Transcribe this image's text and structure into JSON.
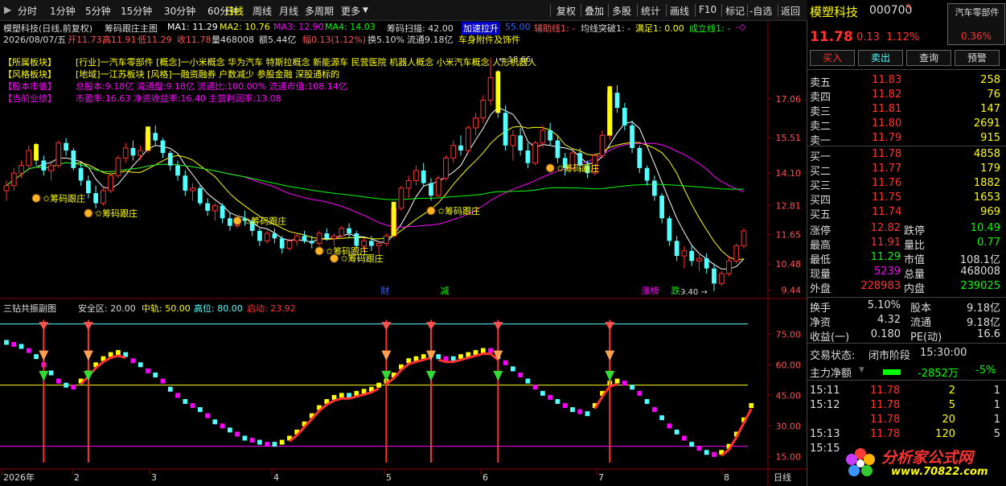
{
  "menu": {
    "periods": [
      "分时",
      "1分钟",
      "5分钟",
      "15分钟",
      "30分钟",
      "60分钟",
      "日线",
      "周线",
      "月线",
      "多周期",
      "更多"
    ],
    "active_period": "日线",
    "tools": [
      "复权",
      "叠加",
      "多股",
      "统计",
      "画线",
      "F10",
      "标记",
      "-自选",
      "返回"
    ]
  },
  "header": {
    "title": "模塑科技(日线,前复权)",
    "indicator_name": "筹码跟庄主图",
    "ma1": "MA1: 11.29",
    "ma2": "MA2: 10.76",
    "ma3": "MA3: 12.90",
    "ma4": "MA4: 14.03",
    "scan": "筹码扫描: 42.00",
    "strong_label": "加速拉升",
    "strong_value": "55.00",
    "aux": "辅助线1: -",
    "breakout": "均线突破1: -",
    "satisfied": "满足1: 0.00",
    "formed": "成立线1: -",
    "date_line": "2026/08/07/五",
    "open": "开11.73",
    "high": "高11.91",
    "low": "低11.29",
    "close": "收11.78",
    "volume": "量468008",
    "amount": "额5.44亿",
    "amplitude": "幅0.13(1.12%)",
    "turnover": "换5.10%",
    "float": "流通9.18亿",
    "industry": "车身附件及饰件"
  },
  "info": {
    "sector_label": "【所属板块】",
    "sector_value": "[行业]一汽车零部件 [概念]一小米概念 华为汽车 特斯拉概念 新能源车 民营医院 机器人概念 小米汽车概念 人形机器人",
    "style_label": "【风格板块】",
    "style_value": "[地域]一江苏板块 [风格]一融资融券 户数减少 参股金融 深股通标的",
    "capital_label": "【股本市值】",
    "capital_value": "总股本:9.18亿 流通盘:9.18亿 流通比:100.00% 流通市值:108.14亿",
    "perf_label": "【当前业绩】",
    "perf_value": "市盈率:16.63 净资收益率:16.40 主营利润率:13.08"
  },
  "main_chart": {
    "price_ticks": [
      "17.06",
      "15.51",
      "14.10",
      "12.81",
      "11.65",
      "10.48",
      "9.44"
    ],
    "peak_label": "18.66",
    "low_label": "9.40",
    "marker_label": "筹码跟庄",
    "event_tags": [
      "财",
      "减",
      "涨榜",
      "跌"
    ]
  },
  "sub_chart": {
    "title": "三钻共振副图",
    "safe": "安全区: 20.00",
    "mid": "中轨: 50.00",
    "high": "高位: 80.00",
    "start": "启动: 23.92",
    "ticks": [
      "75.00",
      "60.00",
      "45.00",
      "30.00",
      "15.00"
    ]
  },
  "x_axis": {
    "labels": [
      "2026年",
      "2",
      "3",
      "4",
      "5",
      "6",
      "7",
      "8"
    ],
    "period": "日线"
  },
  "chart_data": {
    "type": "candlestick",
    "note": "",
    "ohlc": [
      [
        13.4,
        13.8,
        13.0,
        13.6
      ],
      [
        13.6,
        14.3,
        13.4,
        14.1
      ],
      [
        14.1,
        14.6,
        13.9,
        14.4
      ],
      [
        14.4,
        15.2,
        14.2,
        15.0
      ],
      [
        15.0,
        15.3,
        14.4,
        14.6
      ],
      [
        14.6,
        14.8,
        14.0,
        14.2
      ],
      [
        14.2,
        14.6,
        13.8,
        14.4
      ],
      [
        14.4,
        15.4,
        14.3,
        15.3
      ],
      [
        15.3,
        15.5,
        14.8,
        15.0
      ],
      [
        15.0,
        15.1,
        14.2,
        14.3
      ],
      [
        14.3,
        14.5,
        13.6,
        13.8
      ],
      [
        13.8,
        14.0,
        13.1,
        13.3
      ],
      [
        13.3,
        13.6,
        12.7,
        12.9
      ],
      [
        12.9,
        13.5,
        12.8,
        13.4
      ],
      [
        13.4,
        14.2,
        13.3,
        14.0
      ],
      [
        14.0,
        14.8,
        13.9,
        14.7
      ],
      [
        14.7,
        15.3,
        14.5,
        15.1
      ],
      [
        15.1,
        15.4,
        14.6,
        14.8
      ],
      [
        14.8,
        15.2,
        14.6,
        15.0
      ],
      [
        15.0,
        15.9,
        14.9,
        15.7
      ],
      [
        15.7,
        16.0,
        15.2,
        15.4
      ],
      [
        15.4,
        15.5,
        14.7,
        14.9
      ],
      [
        14.9,
        15.0,
        14.2,
        14.4
      ],
      [
        14.4,
        14.6,
        13.8,
        14.0
      ],
      [
        14.0,
        14.2,
        13.2,
        13.4
      ],
      [
        13.4,
        13.7,
        13.0,
        13.5
      ],
      [
        13.5,
        13.6,
        12.8,
        12.9
      ],
      [
        12.9,
        13.1,
        12.4,
        12.6
      ],
      [
        12.6,
        12.9,
        12.2,
        12.8
      ],
      [
        12.8,
        12.9,
        12.1,
        12.3
      ],
      [
        12.3,
        12.5,
        11.8,
        12.0
      ],
      [
        12.0,
        12.4,
        11.9,
        12.3
      ],
      [
        12.3,
        12.6,
        12.0,
        12.2
      ],
      [
        12.2,
        12.3,
        11.6,
        11.8
      ],
      [
        11.8,
        11.9,
        11.2,
        11.4
      ],
      [
        11.4,
        11.8,
        11.3,
        11.7
      ],
      [
        11.7,
        11.9,
        11.3,
        11.5
      ],
      [
        11.5,
        11.6,
        10.9,
        11.1
      ],
      [
        11.1,
        11.5,
        11.0,
        11.4
      ],
      [
        11.4,
        11.7,
        11.2,
        11.6
      ],
      [
        11.6,
        11.8,
        11.3,
        11.4
      ],
      [
        11.4,
        11.6,
        11.1,
        11.3
      ],
      [
        11.3,
        11.8,
        11.2,
        11.7
      ],
      [
        11.7,
        11.9,
        11.4,
        11.5
      ],
      [
        11.5,
        11.7,
        11.2,
        11.6
      ],
      [
        11.6,
        12.0,
        11.5,
        11.9
      ],
      [
        11.9,
        12.1,
        11.5,
        11.7
      ],
      [
        11.7,
        11.8,
        11.1,
        11.2
      ],
      [
        11.2,
        11.5,
        11.0,
        11.4
      ],
      [
        11.4,
        11.6,
        11.0,
        11.2
      ],
      [
        11.2,
        11.4,
        10.9,
        11.3
      ],
      [
        11.3,
        11.7,
        11.2,
        11.6
      ],
      [
        11.6,
        12.8,
        11.5,
        12.7
      ],
      [
        12.7,
        13.6,
        12.6,
        13.5
      ],
      [
        13.5,
        14.0,
        13.1,
        13.8
      ],
      [
        13.8,
        14.4,
        13.6,
        14.2
      ],
      [
        14.2,
        14.5,
        13.6,
        13.7
      ],
      [
        13.7,
        13.9,
        13.0,
        13.2
      ],
      [
        13.2,
        14.0,
        13.1,
        13.9
      ],
      [
        13.9,
        14.8,
        13.8,
        14.7
      ],
      [
        14.7,
        15.4,
        14.5,
        15.2
      ],
      [
        15.2,
        15.6,
        14.8,
        15.0
      ],
      [
        15.0,
        16.0,
        14.9,
        15.9
      ],
      [
        15.9,
        16.5,
        15.6,
        16.3
      ],
      [
        16.3,
        17.2,
        16.1,
        17.0
      ],
      [
        17.0,
        18.7,
        16.8,
        17.9
      ],
      [
        17.9,
        18.2,
        16.3,
        16.5
      ],
      [
        16.5,
        16.8,
        15.0,
        15.2
      ],
      [
        15.2,
        15.8,
        14.6,
        15.6
      ],
      [
        15.6,
        15.9,
        14.8,
        15.0
      ],
      [
        15.0,
        15.3,
        14.3,
        14.5
      ],
      [
        14.5,
        15.4,
        14.4,
        15.3
      ],
      [
        15.3,
        16.0,
        15.1,
        15.8
      ],
      [
        15.8,
        16.1,
        15.2,
        15.4
      ],
      [
        15.4,
        15.6,
        14.5,
        14.7
      ],
      [
        14.7,
        14.9,
        14.0,
        14.3
      ],
      [
        14.3,
        15.0,
        14.2,
        14.9
      ],
      [
        14.9,
        15.1,
        14.2,
        14.4
      ],
      [
        14.4,
        14.6,
        13.9,
        14.1
      ],
      [
        14.1,
        14.9,
        14.0,
        14.8
      ],
      [
        14.8,
        15.8,
        14.7,
        15.6
      ],
      [
        15.6,
        17.6,
        15.4,
        17.3
      ],
      [
        17.3,
        17.6,
        16.5,
        16.7
      ],
      [
        16.7,
        16.9,
        15.8,
        16.0
      ],
      [
        16.0,
        16.2,
        14.9,
        15.1
      ],
      [
        15.1,
        15.2,
        14.1,
        14.3
      ],
      [
        14.3,
        14.4,
        13.6,
        13.8
      ],
      [
        13.8,
        14.0,
        13.0,
        13.2
      ],
      [
        13.2,
        13.3,
        12.1,
        12.3
      ],
      [
        12.3,
        12.4,
        11.2,
        11.4
      ],
      [
        11.4,
        11.6,
        10.6,
        10.8
      ],
      [
        10.8,
        11.2,
        10.3,
        11.0
      ],
      [
        11.0,
        11.2,
        10.4,
        10.6
      ],
      [
        10.6,
        10.9,
        10.2,
        10.7
      ],
      [
        10.7,
        10.9,
        10.1,
        10.3
      ],
      [
        10.3,
        10.5,
        9.4,
        9.7
      ],
      [
        9.7,
        10.2,
        9.6,
        10.1
      ],
      [
        10.1,
        10.8,
        10.0,
        10.6
      ],
      [
        10.6,
        11.3,
        10.5,
        11.2
      ],
      [
        11.2,
        11.9,
        11.1,
        11.8
      ]
    ],
    "price_range": [
      9.2,
      19.2
    ],
    "sub_range": [
      10,
      85
    ],
    "sub_levels": [
      20,
      50,
      80
    ],
    "osc": [
      71,
      70,
      69,
      67,
      64,
      60,
      56,
      52,
      50,
      49,
      52,
      56,
      60,
      63,
      65,
      66,
      65,
      62,
      60,
      57,
      55,
      52,
      48,
      45,
      42,
      40,
      38,
      35,
      32,
      30,
      28,
      26,
      24,
      23,
      22,
      21,
      21,
      22,
      24,
      27,
      31,
      35,
      39,
      42,
      44,
      45,
      45,
      46,
      47,
      48,
      50,
      52,
      55,
      59,
      62,
      63,
      64,
      65,
      64,
      63,
      63,
      64,
      65,
      66,
      67,
      67,
      64,
      61,
      58,
      55,
      52,
      49,
      46,
      44,
      42,
      40,
      38,
      37,
      36,
      40,
      46,
      51,
      52,
      51,
      49,
      46,
      42,
      38,
      34,
      30,
      27,
      24,
      21,
      19,
      17,
      16,
      17,
      20,
      26,
      33,
      40
    ]
  },
  "right_panel": {
    "name": "模塑科技",
    "code": "000700",
    "flag": "R",
    "sector_box": "汽车零部件",
    "sector_pct": "0.36%",
    "price": "11.78",
    "change": "0.13",
    "change_pct": "1.12%",
    "buttons": [
      "买入",
      "卖出",
      "查询",
      "预警"
    ],
    "asks": [
      {
        "label": "卖五",
        "price": "11.83",
        "vol": "258"
      },
      {
        "label": "卖四",
        "price": "11.82",
        "vol": "76"
      },
      {
        "label": "卖三",
        "price": "11.81",
        "vol": "147"
      },
      {
        "label": "卖二",
        "price": "11.80",
        "vol": "2691"
      },
      {
        "label": "卖一",
        "price": "11.79",
        "vol": "915"
      }
    ],
    "bids": [
      {
        "label": "买一",
        "price": "11.78",
        "vol": "4858"
      },
      {
        "label": "买二",
        "price": "11.77",
        "vol": "179"
      },
      {
        "label": "买三",
        "price": "11.76",
        "vol": "1882"
      },
      {
        "label": "买四",
        "price": "11.75",
        "vol": "1653"
      },
      {
        "label": "买五",
        "price": "11.74",
        "vol": "969"
      }
    ],
    "stats": [
      {
        "l1": "涨停",
        "v1": "12.82",
        "l2": "跌停",
        "v2": "10.49"
      },
      {
        "l1": "最高",
        "v1": "11.91",
        "l2": "量比",
        "v2": "0.77"
      },
      {
        "l1": "最低",
        "v1": "11.29",
        "l2": "市值",
        "v2": "108.1亿"
      },
      {
        "l1": "现量",
        "v1": "5239",
        "l2": "总量",
        "v2": "468008"
      },
      {
        "l1": "外盘",
        "v1": "228983",
        "l2": "内盘",
        "v2": "239025"
      }
    ],
    "stats2": [
      {
        "l1": "换手",
        "v1": "5.10%",
        "l2": "股本",
        "v2": "9.18亿"
      },
      {
        "l1": "净资",
        "v1": "4.32",
        "l2": "流通",
        "v2": "9.18亿"
      },
      {
        "l1": "收益(一)",
        "v1": "0.180",
        "l2": "PE(动)",
        "v2": "16.6"
      }
    ],
    "status_label": "交易状态:",
    "status_value": "闭市阶段",
    "status_time": "15:30:00",
    "flow_label": "主力净额",
    "flow_value": "-2852万",
    "flow_pct": "-5%",
    "ticks": [
      {
        "t": "15:11",
        "p": "11.78",
        "v": "2",
        "n": "1"
      },
      {
        "t": "15:12",
        "p": "11.78",
        "v": "5",
        "n": "1"
      },
      {
        "t": "",
        "p": "11.78",
        "v": "20",
        "n": "1"
      },
      {
        "t": "15:13",
        "p": "11.78",
        "v": "120",
        "n": "5"
      },
      {
        "t": "15:15",
        "p": "",
        "v": "",
        "n": ""
      }
    ],
    "logo_text": "分析家公式网",
    "logo_url": "www.70822.com"
  },
  "colors": {
    "up": "#ff3232",
    "down": "#54ffff",
    "ma_white": "#ffffff",
    "ma_yellow": "#ffff00",
    "ma_magenta": "#ff00ff",
    "ma_green": "#00ff00",
    "grid": "#8b0000"
  }
}
